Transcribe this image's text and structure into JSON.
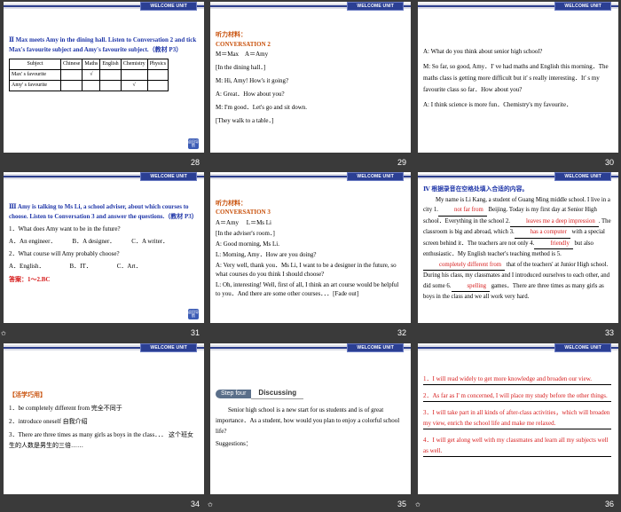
{
  "unit_label": "WELCOME UNIT",
  "back_icon_label": "返回导航",
  "star_glyph": "✩",
  "slides": [
    {
      "page": "28",
      "heading": "Ⅱ Max meets Amy in the dining hall. Listen to Conversation 2 and tick Max's favourite subject and Amy's favourite subject.（教材 P3）",
      "table": {
        "headers": [
          "Subject",
          "Chinese",
          "Maths",
          "English",
          "Chemistry",
          "Physics"
        ],
        "rows": [
          [
            "Max' s favourite",
            "",
            "√",
            "",
            "",
            ""
          ],
          [
            "Amy' s favourite",
            "",
            "",
            "",
            "√",
            ""
          ]
        ]
      }
    },
    {
      "page": "29",
      "label": "听力材料：",
      "title": "CONVERSATION 2",
      "lines": [
        "M＝Max　A＝Amy",
        "[In the dining hall．]",
        "M: Hi, Amy! How's it going?",
        "A: Great．How about you?",
        "M: I'm good．Let's go and sit down.",
        "[They walk to a table．]"
      ]
    },
    {
      "page": "30",
      "lines": [
        "A: What do you think about senior high school?",
        "M: So far, so good, Amy．I' ve had maths and English this morning．The maths class is getting more difficult but it' s really interesting．It' s my favourite class so far．How about you?",
        "A: I think science is more fun．Chemistry's my favourite．"
      ]
    },
    {
      "page": "31",
      "heading": "Ⅲ Amy is talking to Ms Li, a school adviser, about which courses to choose. Listen to Conversation 3 and answer the questions.（教材 P3）",
      "q1": "1．What does Amy want to be in the future?",
      "q1_opts": [
        "A．An engineer．",
        "B．A designer．",
        "C．A writer．"
      ],
      "q2": "2．What course will Amy probably choose?",
      "q2_opts": [
        "A．English．",
        "B．IT．",
        "C．Art．"
      ],
      "answer": "答案：1～2.BC"
    },
    {
      "page": "32",
      "label": "听力材料：",
      "title": "CONVERSATION 3",
      "lines": [
        "A＝Amy　 L＝Ms Li",
        "[In the adviser's room．]",
        "A: Good morning, Ms Li.",
        "L: Morning, Amy．How are you doing?",
        "A: Very well, thank you．Ms Li, I want to be a designer in the future, so what courses do you think I should choose?",
        "L: Oh, interesting! Well, first of all, I think an art course would be helpful to you．And there are some other courses．．．[Fade out]"
      ]
    },
    {
      "page": "33",
      "heading": "Ⅳ 根据录音在空格处填入合适的内容。",
      "segments": [
        "My name is Li Kang, a student of Guang Ming middle school. I live in a city 1.",
        "not far from",
        " Beijing. Today is my first day at Senior High school．Everything in the school 2.",
        "leaves me a deep impression",
        ". The classroom is big and abroad, which 3.",
        "has a computer",
        " with a special screen behind it．The teachers are not only 4.",
        "friendly",
        " but also enthusiastic．My English teacher's teaching method is 5.",
        "completely different from",
        " that of the teachers' at Junior High school. During his class, my classmates and I introduced ourselves to each other, and did some 6.",
        "spelling",
        " games．There are three times as many girls as boys in the class and we all work very hard."
      ]
    },
    {
      "page": "34",
      "label": "【活学巧用】",
      "items": [
        "1．be completely different from 完全不同于",
        "2．introduce oneself 自我介绍",
        "3．There are three times as many girls as boys in the class．．． 这个班女生的人数是男生的三倍……"
      ]
    },
    {
      "page": "35",
      "step_label": "Step four",
      "step_title": "Discussing",
      "body": "Senior high school is a new start for us students and is of great importance．As a student, how would you plan to enjoy a colorful school life?",
      "suggestions": "Suggestions："
    },
    {
      "page": "36",
      "items": [
        "1．I will read widely to get more knowledge and broaden our view.",
        "2．As far as I' m concerned, I will place my study before the other things.",
        "3．I will take part in all kinds of after-class activities，which will broaden my view, enrich the school life and make me relaxed.",
        "4．I will get along well with my classmates and learn all my subjects well as well."
      ]
    }
  ]
}
